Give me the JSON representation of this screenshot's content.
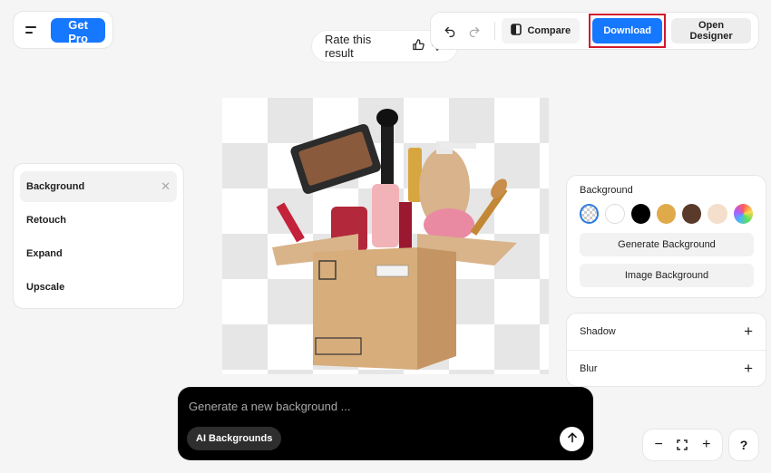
{
  "header": {
    "pro_label": "Get Pro",
    "rate_label": "Rate this result"
  },
  "toolbar": {
    "compare_label": "Compare",
    "download_label": "Download",
    "open_designer_label": "Open Designer"
  },
  "left_panel": {
    "items": [
      {
        "label": "Background"
      },
      {
        "label": "Retouch"
      },
      {
        "label": "Expand"
      },
      {
        "label": "Upscale"
      }
    ]
  },
  "background_panel": {
    "title": "Background",
    "swatches": [
      "transparent",
      "#ffffff",
      "#000000",
      "#e0aa4a",
      "#5a3a2a",
      "#f4dfcc",
      "rainbow"
    ],
    "generate_label": "Generate Background",
    "image_label": "Image Background"
  },
  "effects_panel": {
    "shadow_label": "Shadow",
    "blur_label": "Blur"
  },
  "prompt": {
    "placeholder": "Generate a new background ...",
    "ai_label": "AI Backgrounds"
  },
  "zoom": {
    "help_label": "?"
  },
  "colors": {
    "accent": "#1677ff",
    "highlight_border": "#d11a2a"
  }
}
